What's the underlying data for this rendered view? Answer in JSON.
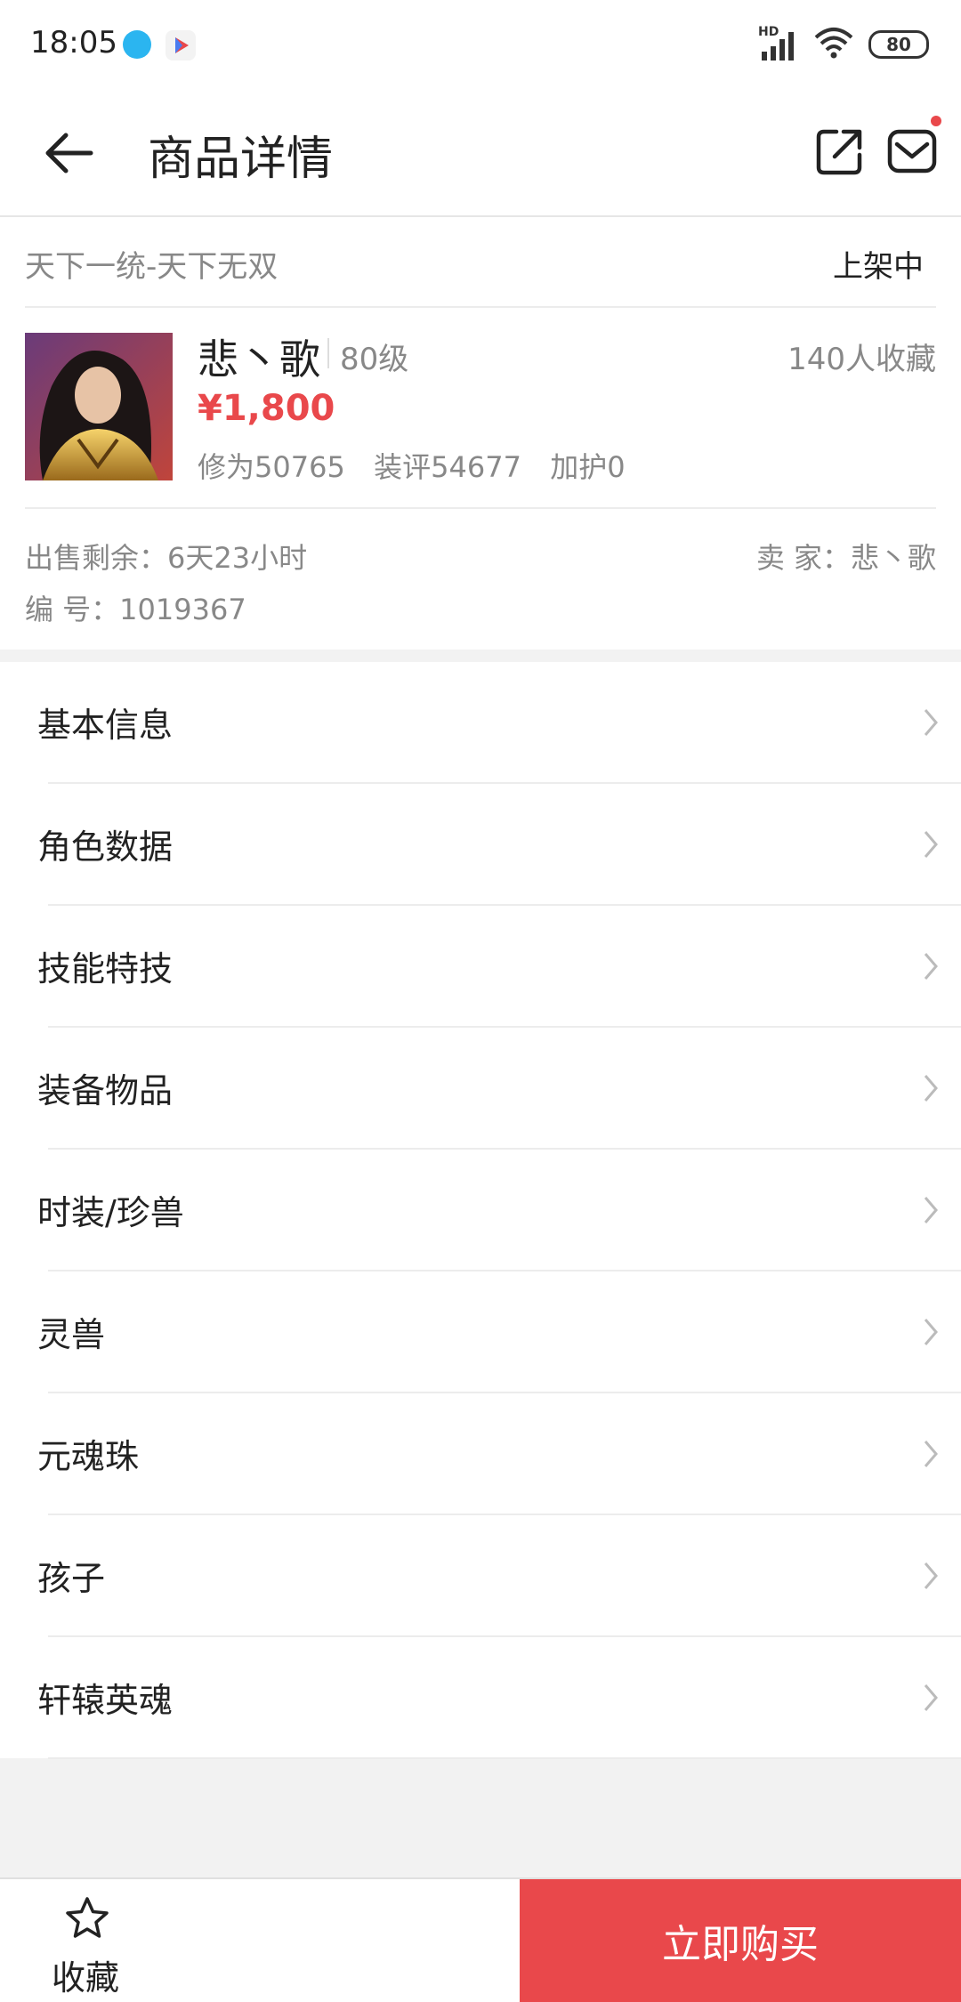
{
  "status_bar": {
    "time": "18:05",
    "network": "HD",
    "battery": "80"
  },
  "header": {
    "title": "商品详情"
  },
  "item": {
    "server": "天下一统-天下无双",
    "status": "上架中",
    "role_name": "悲丶歌",
    "level": "80级",
    "favorites": "140人收藏",
    "price": "¥1,800",
    "stats": "修为50765  装评54677  加护0",
    "remaining": "出售剩余：6天23小时",
    "seller": "卖  家：悲丶歌",
    "serial": "编  号：1019367"
  },
  "menu": {
    "items": [
      {
        "label": "基本信息"
      },
      {
        "label": "角色数据"
      },
      {
        "label": "技能特技"
      },
      {
        "label": "装备物品"
      },
      {
        "label": "时装/珍兽"
      },
      {
        "label": "灵兽"
      },
      {
        "label": "元魂珠"
      },
      {
        "label": "孩子"
      },
      {
        "label": "轩辕英魂"
      }
    ]
  },
  "bottom_bar": {
    "favorite_label": "收藏",
    "buy_label": "立即购买"
  },
  "colors": {
    "accent": "#e9484b",
    "muted_text": "#888888",
    "divider": "#ececec"
  }
}
